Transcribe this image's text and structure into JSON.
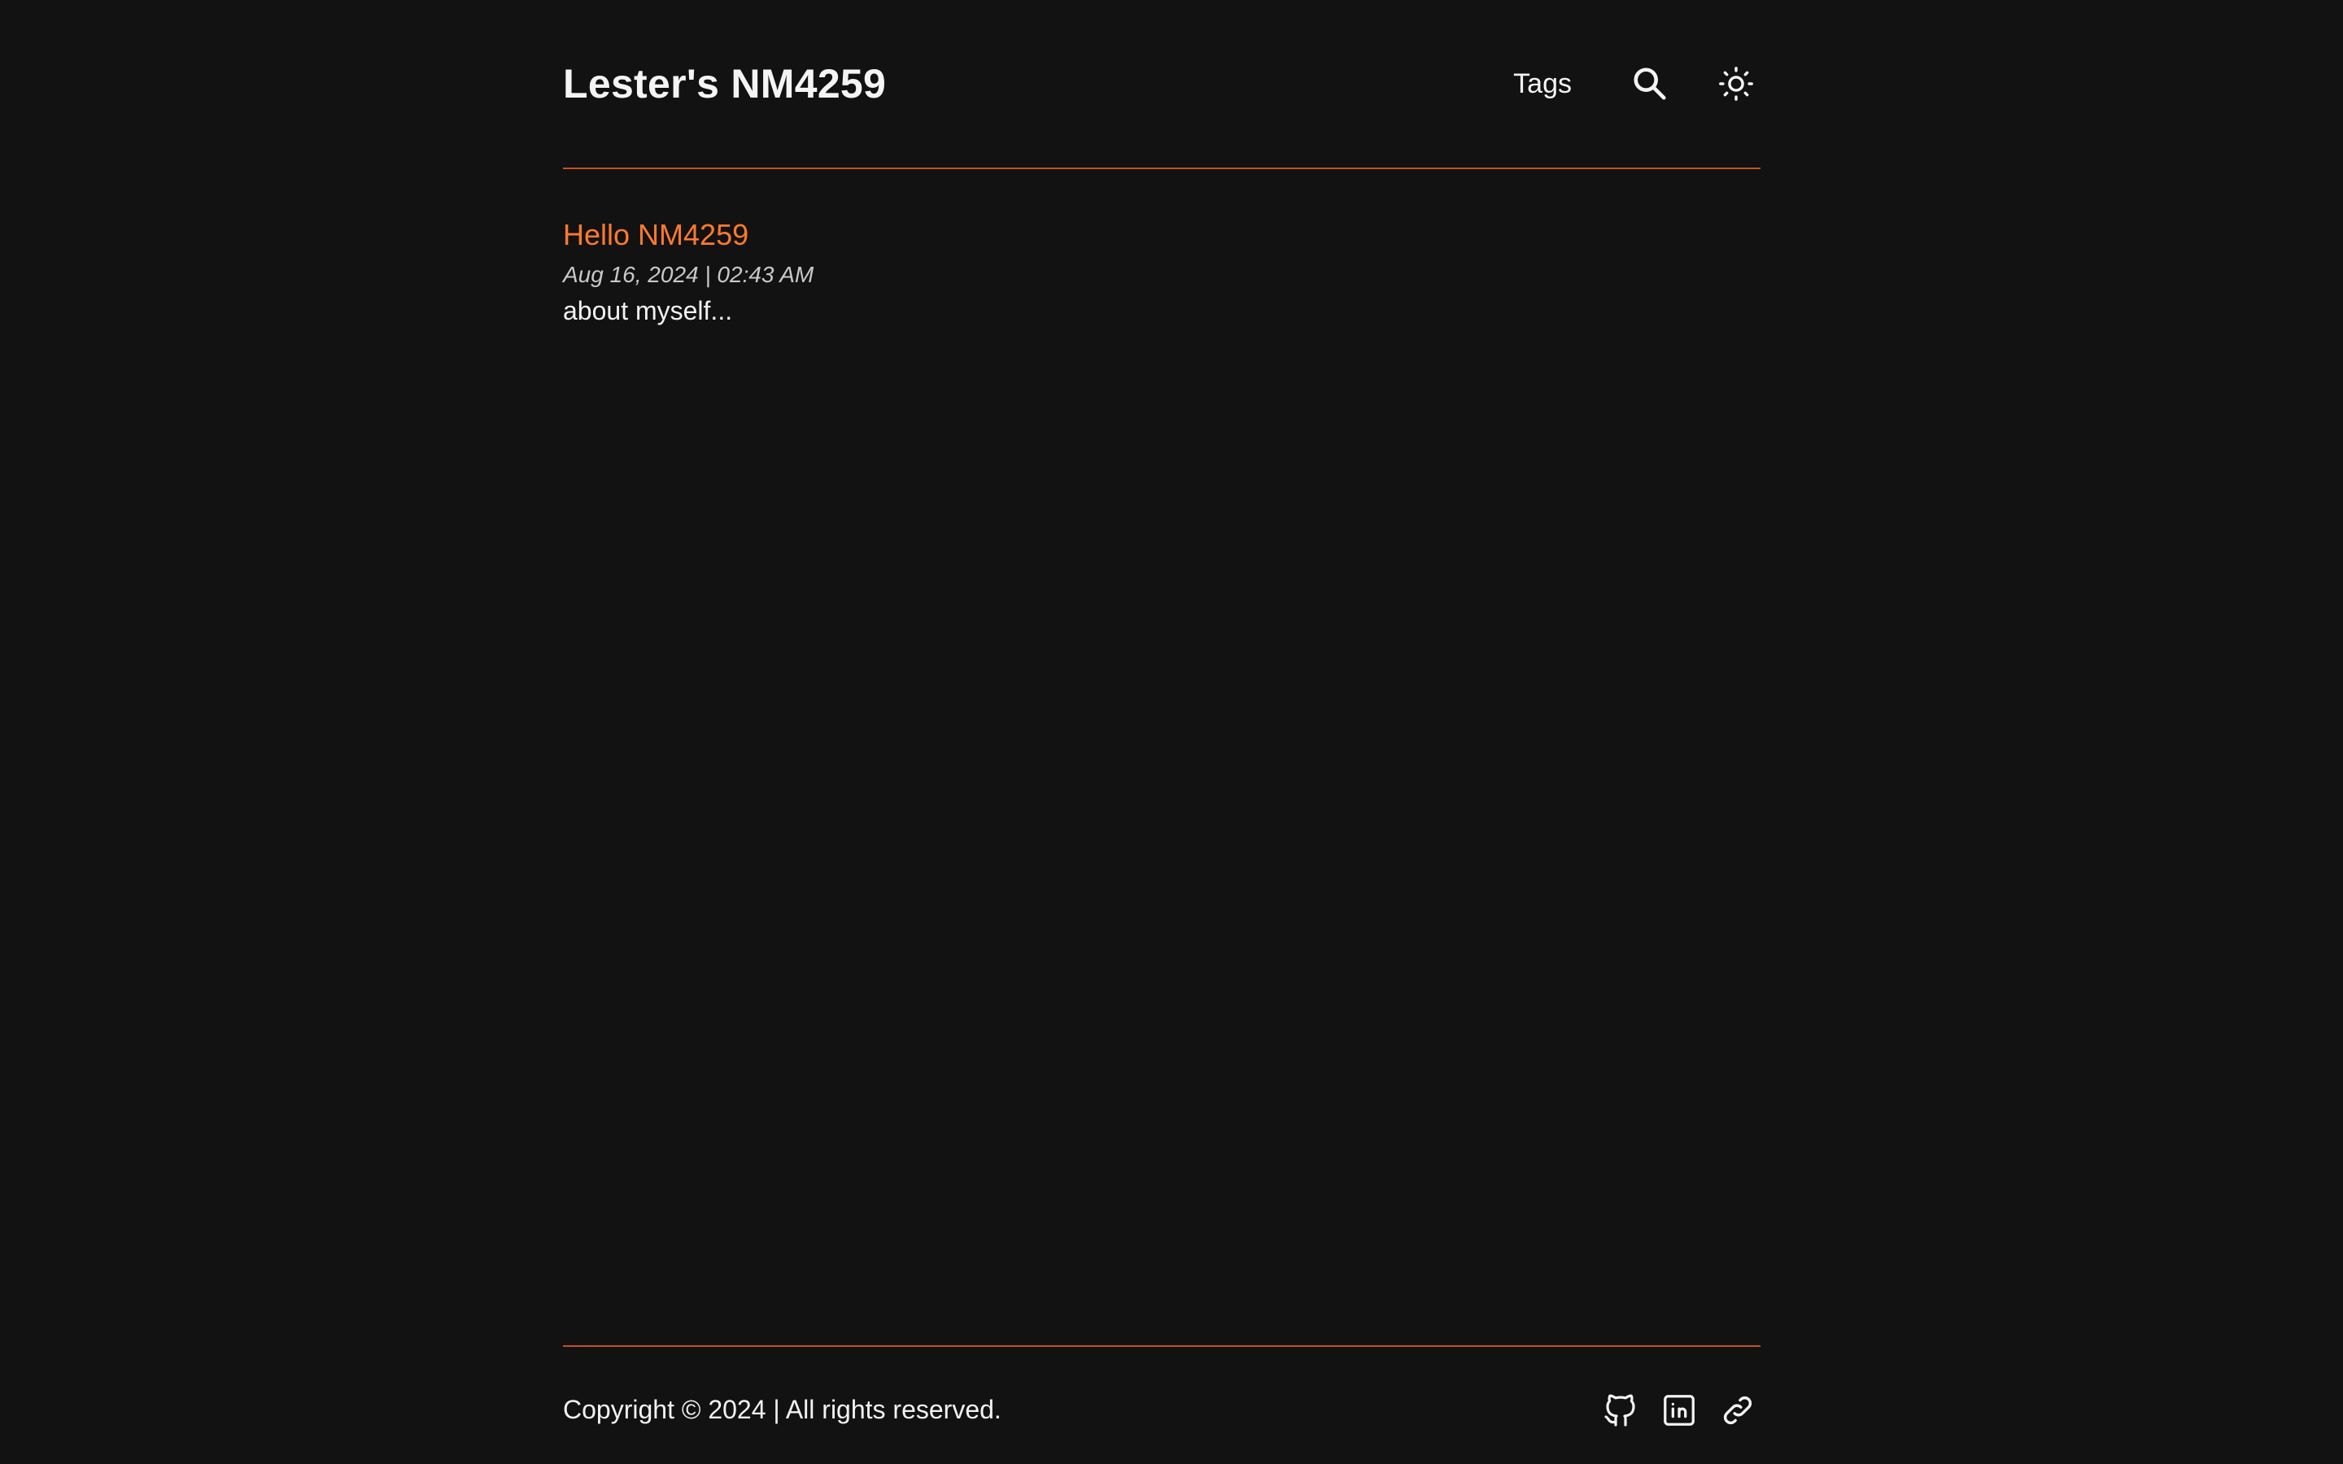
{
  "header": {
    "site_title": "Lester's NM4259",
    "nav": {
      "tags_label": "Tags",
      "search_icon": "search-icon",
      "theme_icon": "sun-icon"
    }
  },
  "posts": [
    {
      "title": "Hello NM4259",
      "date": "Aug 16, 2024 | 02:43 AM",
      "description": "about myself..."
    }
  ],
  "footer": {
    "copyright": "Copyright © 2024 | All rights reserved.",
    "socials": [
      "github-icon",
      "linkedin-icon",
      "link-icon"
    ]
  },
  "colors": {
    "background": "#121212",
    "accent": "#ff7a2f",
    "divider": "#c2531b",
    "text": "#f2f2f2",
    "muted": "#c9c9c9"
  }
}
